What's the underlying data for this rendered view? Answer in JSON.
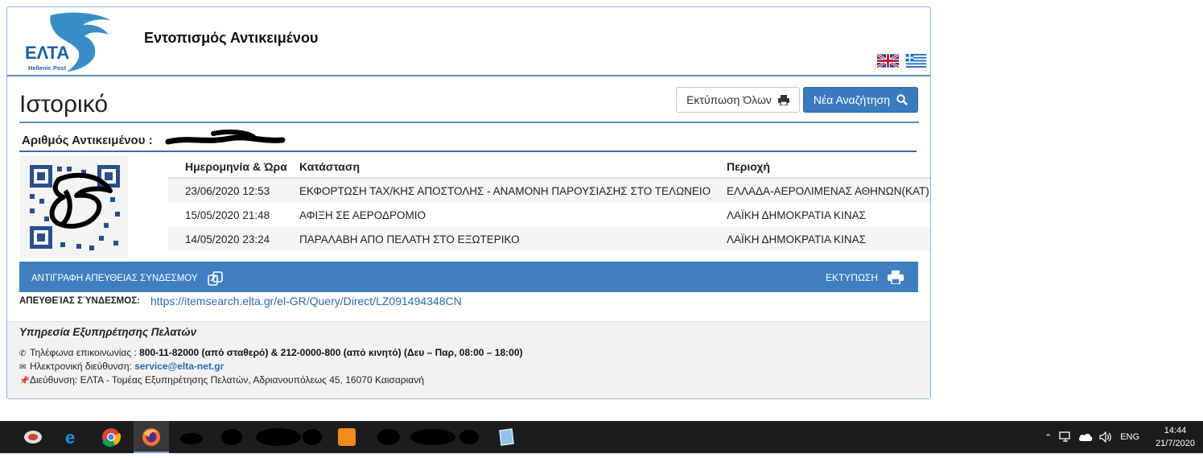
{
  "header": {
    "title": "Εντοπισμός Αντικειμένου",
    "logo_text": "ΕΛΤΑ",
    "logo_sub": "Hellenic Post"
  },
  "history": {
    "title": "Ιστορικό",
    "print_all_label": "Εκτύπωση Όλων",
    "new_search_label": "Νέα Αναζήτηση",
    "item_number_label": "Αριθμός Αντικειμένου :"
  },
  "table": {
    "columns": [
      "Ημερομηνία & Ώρα",
      "Κατάσταση",
      "Περιοχή"
    ],
    "rows": [
      {
        "date": "23/06/2020 12:53",
        "status": "ΕΚΦΟΡΤΩΣΗ ΤΑΧ/ΚΗΣ ΑΠΟΣΤΟΛΗΣ - ΑΝΑΜΟΝΗ ΠΑΡΟΥΣΙΑΣΗΣ ΣΤΟ ΤΕΛΩΝΕΙΟ",
        "area": "ΕΛΛΑΔΑ-ΑΕΡΟΛΙΜΕΝΑΣ ΑΘΗΝΩΝ(ΚΑΤ)"
      },
      {
        "date": "15/05/2020 21:48",
        "status": "ΑΦΙΞΗ ΣΕ ΑΕΡΟΔΡΟΜΙΟ",
        "area": "ΛΑΪΚΗ ΔΗΜΟΚΡΑΤΙΑ ΚΙΝΑΣ"
      },
      {
        "date": "14/05/2020 23:24",
        "status": "ΠΑΡΑΛΑΒΗ ΑΠΟ ΠΕΛΑΤΗ ΣΤΟ ΕΞΩΤΕΡΙΚΟ",
        "area": "ΛΑΪΚΗ ΔΗΜΟΚΡΑΤΙΑ ΚΙΝΑΣ"
      }
    ]
  },
  "actions": {
    "copy_link_label": "ΑΝΤΙΓΡΑΦΗ ΑΠΕΥΘΕΙΑΣ ΣΥΝΔΕΣΜΟΥ",
    "print_label": "ΕΚΤΥΠΩΣΗ"
  },
  "direct_link": {
    "label": "ΑΠΕΥΘΕΊΑΣ ΣΎΝΔΕΣΜΟΣ:",
    "url": "https://itemsearch.elta.gr/el-GR/Query/Direct/LZ091494348CN"
  },
  "footer": {
    "title": "Υπηρεσία Εξυπηρέτησης Πελατών",
    "phone_label": "Τηλέφωνα επικοινωνίας :",
    "phone_value": "800-11-82000 (από σταθερό) & 212-0000-800 (από κινητό) (Δευ – Παρ, 08:00 – 18:00)",
    "email_label": "Ηλεκτρονική διεύθυνση:",
    "email_value": "service@elta-net.gr",
    "address": "Διεύθυνση: ΕΛΤΑ - Τομέας Εξυπηρέτησης Πελατών, Αδριανουπόλεως 45, 16070 Καισαριανή"
  },
  "taskbar": {
    "language": "ENG",
    "time": "14:44",
    "date": "21/7/2020"
  },
  "colors": {
    "accent": "#3f7fc0",
    "rule": "#5b8ebf",
    "link": "#2b6aa8"
  }
}
